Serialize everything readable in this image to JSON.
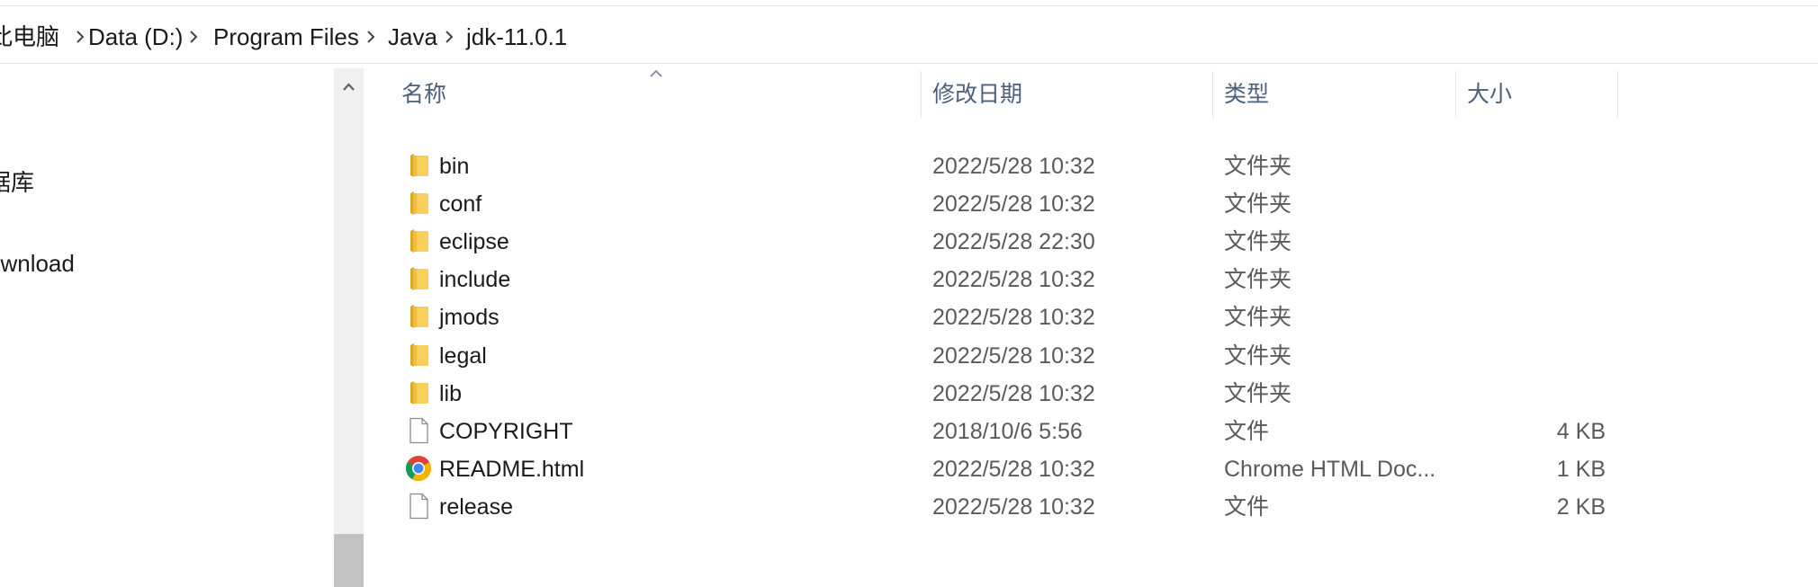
{
  "breadcrumb": {
    "items": [
      {
        "label": "此电脑"
      },
      {
        "label": "Data (D:)"
      },
      {
        "label": "Program Files"
      },
      {
        "label": "Java"
      },
      {
        "label": "jdk-11.0.1"
      }
    ]
  },
  "nav": {
    "items": [
      {
        "label": "据库"
      },
      {
        "label": "ownload"
      }
    ]
  },
  "columns": {
    "name": "名称",
    "date": "修改日期",
    "type": "类型",
    "size": "大小"
  },
  "files": [
    {
      "name": "bin",
      "date": "2022/5/28 10:32",
      "type": "文件夹",
      "size": "",
      "icon": "folder-icon"
    },
    {
      "name": "conf",
      "date": "2022/5/28 10:32",
      "type": "文件夹",
      "size": "",
      "icon": "folder-icon"
    },
    {
      "name": "eclipse",
      "date": "2022/5/28 22:30",
      "type": "文件夹",
      "size": "",
      "icon": "folder-icon"
    },
    {
      "name": "include",
      "date": "2022/5/28 10:32",
      "type": "文件夹",
      "size": "",
      "icon": "folder-icon"
    },
    {
      "name": "jmods",
      "date": "2022/5/28 10:32",
      "type": "文件夹",
      "size": "",
      "icon": "folder-icon"
    },
    {
      "name": "legal",
      "date": "2022/5/28 10:32",
      "type": "文件夹",
      "size": "",
      "icon": "folder-icon"
    },
    {
      "name": "lib",
      "date": "2022/5/28 10:32",
      "type": "文件夹",
      "size": "",
      "icon": "folder-icon"
    },
    {
      "name": "COPYRIGHT",
      "date": "2018/10/6 5:56",
      "type": "文件",
      "size": "4 KB",
      "icon": "file-icon"
    },
    {
      "name": "README.html",
      "date": "2022/5/28 10:32",
      "type": "Chrome HTML Doc...",
      "size": "1 KB",
      "icon": "chrome-icon"
    },
    {
      "name": "release",
      "date": "2022/5/28 10:32",
      "type": "文件",
      "size": "2 KB",
      "icon": "file-icon"
    }
  ],
  "colors": {
    "header_text": "#4c607a",
    "folder_yellow": "#f8cf5a",
    "scroll_track": "#f0f0f0",
    "scroll_thumb": "#c2c2c2"
  }
}
